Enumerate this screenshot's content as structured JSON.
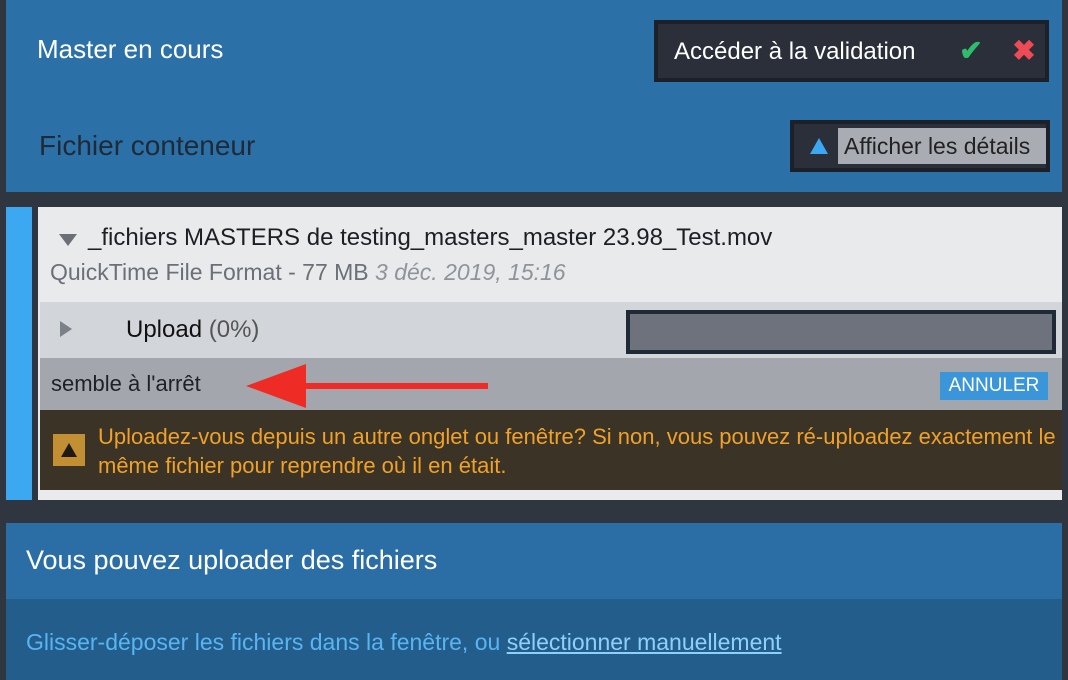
{
  "header": {
    "title": "Master en cours",
    "validation_label": "Accéder à la validation",
    "validation_accept_icon": "check-icon",
    "validation_reject_icon": "close-icon"
  },
  "container": {
    "title": "Fichier conteneur",
    "details_button_label": "Afficher les détails",
    "details_icon": "triangle-up-icon"
  },
  "file": {
    "name": "_fichiers MASTERS de testing_masters_master 23.98_Test.mov",
    "meta": "QuickTime File Format - 77 MB",
    "date": "3 déc. 2019, 15:16",
    "upload": {
      "label": "Upload",
      "percent_text": "(0%)",
      "progress": 0
    },
    "status": "semble à l'arrêt",
    "cancel_label": "ANNULER",
    "warning": "Uploadez-vous depuis un autre onglet ou fenêtre? Si non, vous pouvez ré-uploadez exactement le même fichier pour reprendre où il en était."
  },
  "upload_area": {
    "title": "Vous pouvez uploader des fichiers",
    "drop_text": "Glisser-déposer les fichiers dans la fenêtre, ou",
    "select_link": "sélectionner manuellement"
  },
  "colors": {
    "accent": "#3da8f2",
    "warning": "#f0a12a",
    "annotation_arrow": "#ee2b24",
    "check": "#2ebd6b",
    "close": "#ee4b57"
  }
}
